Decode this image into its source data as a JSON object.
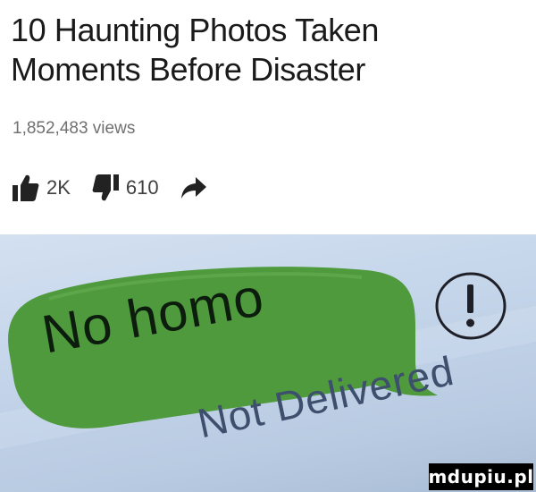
{
  "video": {
    "title": "10 Haunting Photos Taken Moments Before Disaster",
    "views": "1,852,483 views",
    "likes": "2K",
    "dislikes": "610"
  },
  "icons": {
    "like": "thumbs-up-icon",
    "dislike": "thumbs-down-icon",
    "share": "share-arrow-icon",
    "error": "exclamation-circle-icon"
  },
  "message": {
    "bubble_text": "No homo",
    "status": "Not Delivered",
    "bubble_color": "#4e9a3d"
  },
  "watermark": "mdupiu.pl"
}
